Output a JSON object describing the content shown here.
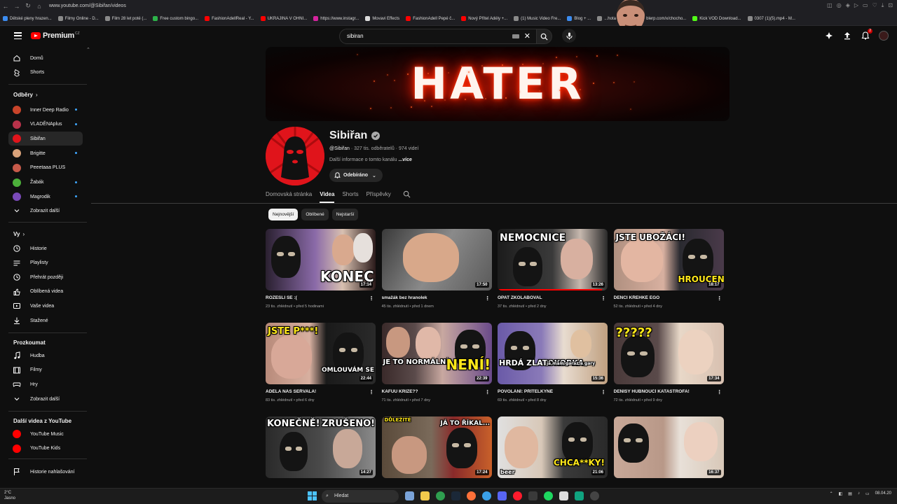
{
  "browser": {
    "url": "www.youtube.com/@Sibiřan/videos",
    "bookmarks": [
      {
        "label": "Dětské pleny hrazen...",
        "color": "#3c8cf0"
      },
      {
        "label": "Filmy Online - D...",
        "color": "#8a8a8a"
      },
      {
        "label": "Film 28 let poté (...",
        "color": "#8a8a8a"
      },
      {
        "label": "Free custom bingo...",
        "color": "#2db34a"
      },
      {
        "label": "FashionAdellReal - Y...",
        "color": "#ff0000"
      },
      {
        "label": "UKRAJINA V OHNI...",
        "color": "#ff0000"
      },
      {
        "label": "https://www.instagr...",
        "color": "#d6249f"
      },
      {
        "label": "Movavi Effects",
        "color": "#dddddd"
      },
      {
        "label": "FashionAdell Pepé č...",
        "color": "#ff0000"
      },
      {
        "label": "Nový Přítel Adély +...",
        "color": "#ff0000"
      },
      {
        "label": "(1) Music Video Fre...",
        "color": "#8a8a8a"
      },
      {
        "label": "Blog + ...",
        "color": "#3c8cf0"
      },
      {
        "label": "...hota | Stream",
        "color": "#8a8a8a"
      },
      {
        "label": "blerp.com/x/chocho...",
        "color": "#8a8a8a"
      },
      {
        "label": "Kick VOD Download...",
        "color": "#53fc18"
      },
      {
        "label": "0307 (1)(5).mp4 - M...",
        "color": "#8a8a8a"
      }
    ]
  },
  "header": {
    "logo_text": "Premium",
    "logo_country": "CZ",
    "search_value": "sibiran",
    "notification_count": "2",
    "overlay_text": "x2"
  },
  "sidebar": {
    "top": [
      {
        "label": "Domů",
        "icon": "home-icon"
      },
      {
        "label": "Shorts",
        "icon": "shorts-icon"
      }
    ],
    "subscriptions_title": "Odběry",
    "subscriptions": [
      {
        "label": "Inner Deep Radio",
        "color": "#c8442a",
        "dot": true
      },
      {
        "label": "VLADĚNAplus",
        "color": "#b8324a",
        "dot": true
      },
      {
        "label": "Sibiřan",
        "color": "#e0141b",
        "dot": false
      },
      {
        "label": "Brigitte",
        "color": "#d9a27a",
        "dot": true
      },
      {
        "label": "Peeetaaa PLUS",
        "color": "#c75a4a",
        "dot": false
      },
      {
        "label": "Žabák",
        "color": "#4caf3a",
        "dot": true
      },
      {
        "label": "Magrodik",
        "color": "#7a4ab8",
        "dot": true
      }
    ],
    "show_more": "Zobrazit další",
    "you_title": "Vy",
    "you": [
      {
        "label": "Historie",
        "icon": "history-icon"
      },
      {
        "label": "Playlisty",
        "icon": "playlists-icon"
      },
      {
        "label": "Přehrát později",
        "icon": "watch-later-icon"
      },
      {
        "label": "Oblíbená videa",
        "icon": "liked-icon"
      },
      {
        "label": "Vaše videa",
        "icon": "your-videos-icon"
      },
      {
        "label": "Stažené",
        "icon": "downloads-icon"
      }
    ],
    "explore_title": "Prozkoumat",
    "explore": [
      {
        "label": "Hudba",
        "icon": "music-icon"
      },
      {
        "label": "Filmy",
        "icon": "movies-icon"
      },
      {
        "label": "Hry",
        "icon": "gaming-icon"
      },
      {
        "label": "Zobrazit další",
        "icon": "chevron-down-icon"
      }
    ],
    "more_title": "Další videa z YouTube",
    "more": [
      {
        "label": "YouTube Music"
      },
      {
        "label": "YouTube Kids"
      }
    ],
    "report_history": "Historie nahlašování"
  },
  "banner": {
    "text": "HATER"
  },
  "channel": {
    "name": "Sibiřan",
    "handle": "@Sibiřan",
    "meta_rest": " · 327 tis. odběratelů · 974 videí",
    "more_info": "Další informace o tomto kanálu",
    "more_link": " ...více",
    "subscribed_label": "Odebíráno",
    "tabs": [
      "Domovská stránka",
      "Videa",
      "Shorts",
      "Příspěvky"
    ],
    "active_tab": "Videa",
    "chips": [
      "Nejnovější",
      "Oblíbené",
      "Nejstarší"
    ]
  },
  "videos": [
    {
      "title": "ROZEŠLI SE :(",
      "meta": "23 tis. zhlédnutí • před 5 hodinami",
      "duration": "17:14",
      "caption": "KONEC",
      "progress": 0
    },
    {
      "title": "smažák bez hranolek",
      "meta": "45 tis. zhlédnutí • před 1 dnem",
      "duration": "17:50",
      "caption": "",
      "progress": 0
    },
    {
      "title": "OPAT ZKOLABOVAL",
      "meta": "37 tis. zhlédnutí • před 2 dny",
      "duration": "13:26",
      "caption": "NEMOCNICE",
      "progress": 0.95
    },
    {
      "title": "DENČI KŘEHKÉ EGO",
      "meta": "52 tis. zhlédnutí • před 4 dny",
      "duration": "18:17",
      "caption": "JSTE UBOŽÁCI!",
      "caption2": "HROUCENÍ",
      "progress": 0
    },
    {
      "title": "ADÉLA NÁS SEŘVALA!",
      "meta": "83 tis. zhlédnutí • před 6 dny",
      "duration": "22:44",
      "caption": "JSTE P***!",
      "caption2": "OMLOUVÁM SE",
      "progress": 0
    },
    {
      "title": "KAFUU KRIZE??",
      "meta": "71 tis. zhlédnutí • před 7 dny",
      "duration": "22:39",
      "caption": "JE TO NORMÁLNÍ",
      "caption2": "NENÍ!",
      "progress": 0
    },
    {
      "title": "POVOLÁNÍ: PŘÍTELKYNĚ",
      "meta": "69 tis. zhlédnutí • před 8 dny",
      "duration": "15:36",
      "caption": "HRDÁ ZLATOKOPKA",
      "caption2": "já mám garaz a gary",
      "progress": 0
    },
    {
      "title": "DENISY HUBNOUCÍ KATASTROFA!",
      "meta": "72 tis. zhlédnutí • před 9 dny",
      "duration": "17:34",
      "caption": "?????",
      "progress": 0
    },
    {
      "title": "",
      "meta": "",
      "duration": "14:27",
      "caption": "KONEČNĚ!",
      "caption2": "ZRUŠENO!",
      "progress": 0
    },
    {
      "title": "",
      "meta": "",
      "duration": "17:24",
      "caption": "JÁ TO ŘÍKAL...",
      "caption2": "DŮLEŽITÉ",
      "progress": 0
    },
    {
      "title": "",
      "meta": "",
      "duration": "21:06",
      "caption": "CHCA**KY!",
      "caption2": "beer",
      "progress": 0
    },
    {
      "title": "",
      "meta": "",
      "duration": "16:37",
      "caption": "",
      "progress": 0
    }
  ],
  "taskbar": {
    "weather_temp": "2°C",
    "weather_desc": "Jasno",
    "search_label": "Hledat",
    "date": "08.04.20"
  }
}
